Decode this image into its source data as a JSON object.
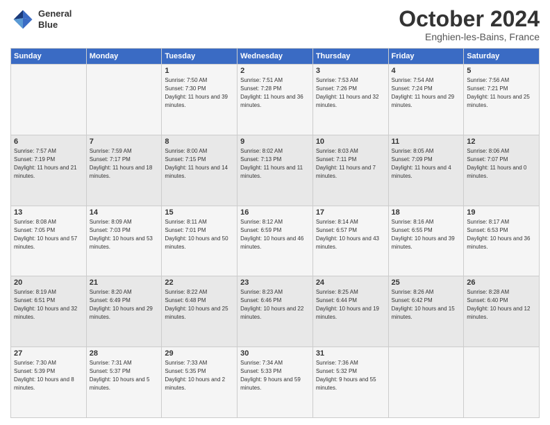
{
  "header": {
    "logo_line1": "General",
    "logo_line2": "Blue",
    "month": "October 2024",
    "location": "Enghien-les-Bains, France"
  },
  "weekdays": [
    "Sunday",
    "Monday",
    "Tuesday",
    "Wednesday",
    "Thursday",
    "Friday",
    "Saturday"
  ],
  "weeks": [
    [
      {
        "day": "",
        "sunrise": "",
        "sunset": "",
        "daylight": ""
      },
      {
        "day": "",
        "sunrise": "",
        "sunset": "",
        "daylight": ""
      },
      {
        "day": "1",
        "sunrise": "Sunrise: 7:50 AM",
        "sunset": "Sunset: 7:30 PM",
        "daylight": "Daylight: 11 hours and 39 minutes."
      },
      {
        "day": "2",
        "sunrise": "Sunrise: 7:51 AM",
        "sunset": "Sunset: 7:28 PM",
        "daylight": "Daylight: 11 hours and 36 minutes."
      },
      {
        "day": "3",
        "sunrise": "Sunrise: 7:53 AM",
        "sunset": "Sunset: 7:26 PM",
        "daylight": "Daylight: 11 hours and 32 minutes."
      },
      {
        "day": "4",
        "sunrise": "Sunrise: 7:54 AM",
        "sunset": "Sunset: 7:24 PM",
        "daylight": "Daylight: 11 hours and 29 minutes."
      },
      {
        "day": "5",
        "sunrise": "Sunrise: 7:56 AM",
        "sunset": "Sunset: 7:21 PM",
        "daylight": "Daylight: 11 hours and 25 minutes."
      }
    ],
    [
      {
        "day": "6",
        "sunrise": "Sunrise: 7:57 AM",
        "sunset": "Sunset: 7:19 PM",
        "daylight": "Daylight: 11 hours and 21 minutes."
      },
      {
        "day": "7",
        "sunrise": "Sunrise: 7:59 AM",
        "sunset": "Sunset: 7:17 PM",
        "daylight": "Daylight: 11 hours and 18 minutes."
      },
      {
        "day": "8",
        "sunrise": "Sunrise: 8:00 AM",
        "sunset": "Sunset: 7:15 PM",
        "daylight": "Daylight: 11 hours and 14 minutes."
      },
      {
        "day": "9",
        "sunrise": "Sunrise: 8:02 AM",
        "sunset": "Sunset: 7:13 PM",
        "daylight": "Daylight: 11 hours and 11 minutes."
      },
      {
        "day": "10",
        "sunrise": "Sunrise: 8:03 AM",
        "sunset": "Sunset: 7:11 PM",
        "daylight": "Daylight: 11 hours and 7 minutes."
      },
      {
        "day": "11",
        "sunrise": "Sunrise: 8:05 AM",
        "sunset": "Sunset: 7:09 PM",
        "daylight": "Daylight: 11 hours and 4 minutes."
      },
      {
        "day": "12",
        "sunrise": "Sunrise: 8:06 AM",
        "sunset": "Sunset: 7:07 PM",
        "daylight": "Daylight: 11 hours and 0 minutes."
      }
    ],
    [
      {
        "day": "13",
        "sunrise": "Sunrise: 8:08 AM",
        "sunset": "Sunset: 7:05 PM",
        "daylight": "Daylight: 10 hours and 57 minutes."
      },
      {
        "day": "14",
        "sunrise": "Sunrise: 8:09 AM",
        "sunset": "Sunset: 7:03 PM",
        "daylight": "Daylight: 10 hours and 53 minutes."
      },
      {
        "day": "15",
        "sunrise": "Sunrise: 8:11 AM",
        "sunset": "Sunset: 7:01 PM",
        "daylight": "Daylight: 10 hours and 50 minutes."
      },
      {
        "day": "16",
        "sunrise": "Sunrise: 8:12 AM",
        "sunset": "Sunset: 6:59 PM",
        "daylight": "Daylight: 10 hours and 46 minutes."
      },
      {
        "day": "17",
        "sunrise": "Sunrise: 8:14 AM",
        "sunset": "Sunset: 6:57 PM",
        "daylight": "Daylight: 10 hours and 43 minutes."
      },
      {
        "day": "18",
        "sunrise": "Sunrise: 8:16 AM",
        "sunset": "Sunset: 6:55 PM",
        "daylight": "Daylight: 10 hours and 39 minutes."
      },
      {
        "day": "19",
        "sunrise": "Sunrise: 8:17 AM",
        "sunset": "Sunset: 6:53 PM",
        "daylight": "Daylight: 10 hours and 36 minutes."
      }
    ],
    [
      {
        "day": "20",
        "sunrise": "Sunrise: 8:19 AM",
        "sunset": "Sunset: 6:51 PM",
        "daylight": "Daylight: 10 hours and 32 minutes."
      },
      {
        "day": "21",
        "sunrise": "Sunrise: 8:20 AM",
        "sunset": "Sunset: 6:49 PM",
        "daylight": "Daylight: 10 hours and 29 minutes."
      },
      {
        "day": "22",
        "sunrise": "Sunrise: 8:22 AM",
        "sunset": "Sunset: 6:48 PM",
        "daylight": "Daylight: 10 hours and 25 minutes."
      },
      {
        "day": "23",
        "sunrise": "Sunrise: 8:23 AM",
        "sunset": "Sunset: 6:46 PM",
        "daylight": "Daylight: 10 hours and 22 minutes."
      },
      {
        "day": "24",
        "sunrise": "Sunrise: 8:25 AM",
        "sunset": "Sunset: 6:44 PM",
        "daylight": "Daylight: 10 hours and 19 minutes."
      },
      {
        "day": "25",
        "sunrise": "Sunrise: 8:26 AM",
        "sunset": "Sunset: 6:42 PM",
        "daylight": "Daylight: 10 hours and 15 minutes."
      },
      {
        "day": "26",
        "sunrise": "Sunrise: 8:28 AM",
        "sunset": "Sunset: 6:40 PM",
        "daylight": "Daylight: 10 hours and 12 minutes."
      }
    ],
    [
      {
        "day": "27",
        "sunrise": "Sunrise: 7:30 AM",
        "sunset": "Sunset: 5:39 PM",
        "daylight": "Daylight: 10 hours and 8 minutes."
      },
      {
        "day": "28",
        "sunrise": "Sunrise: 7:31 AM",
        "sunset": "Sunset: 5:37 PM",
        "daylight": "Daylight: 10 hours and 5 minutes."
      },
      {
        "day": "29",
        "sunrise": "Sunrise: 7:33 AM",
        "sunset": "Sunset: 5:35 PM",
        "daylight": "Daylight: 10 hours and 2 minutes."
      },
      {
        "day": "30",
        "sunrise": "Sunrise: 7:34 AM",
        "sunset": "Sunset: 5:33 PM",
        "daylight": "Daylight: 9 hours and 59 minutes."
      },
      {
        "day": "31",
        "sunrise": "Sunrise: 7:36 AM",
        "sunset": "Sunset: 5:32 PM",
        "daylight": "Daylight: 9 hours and 55 minutes."
      },
      {
        "day": "",
        "sunrise": "",
        "sunset": "",
        "daylight": ""
      },
      {
        "day": "",
        "sunrise": "",
        "sunset": "",
        "daylight": ""
      }
    ]
  ]
}
